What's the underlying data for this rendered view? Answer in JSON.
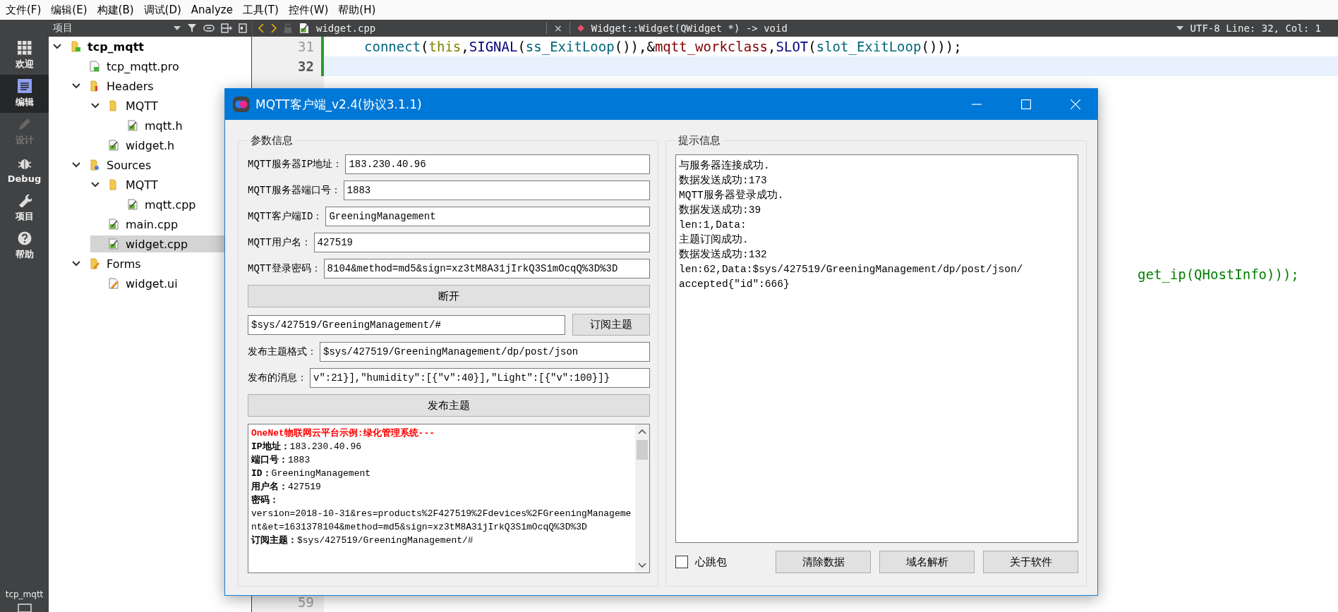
{
  "menu_bar": [
    "文件(F)",
    "编辑(E)",
    "构建(B)",
    "调试(D)",
    "Analyze",
    "工具(T)",
    "控件(W)",
    "帮助(H)"
  ],
  "mode_bar": {
    "modes": [
      {
        "label": "欢迎",
        "kind": "welcome",
        "selected": false,
        "disabled": false
      },
      {
        "label": "编辑",
        "kind": "edit",
        "selected": true,
        "disabled": false
      },
      {
        "label": "设计",
        "kind": "design",
        "selected": false,
        "disabled": true
      },
      {
        "label": "Debug",
        "kind": "debug",
        "selected": false,
        "disabled": false
      },
      {
        "label": "项目",
        "kind": "projects",
        "selected": false,
        "disabled": false
      },
      {
        "label": "帮助",
        "kind": "help",
        "selected": false,
        "disabled": false
      }
    ],
    "session": "tcp_mqtt"
  },
  "project_pane": {
    "title": "项目",
    "tree": [
      {
        "label": "tcp_mqtt",
        "kind": "project",
        "expanded": true,
        "selected": false,
        "children": [
          {
            "label": "tcp_mqtt.pro",
            "kind": "pro",
            "selected": false
          },
          {
            "label": "Headers",
            "kind": "headers",
            "expanded": true,
            "selected": false,
            "children": [
              {
                "label": "MQTT",
                "kind": "folder",
                "expanded": true,
                "selected": false,
                "children": [
                  {
                    "label": "mqtt.h",
                    "kind": "file",
                    "selected": false
                  }
                ]
              },
              {
                "label": "widget.h",
                "kind": "file",
                "selected": false
              }
            ]
          },
          {
            "label": "Sources",
            "kind": "sources",
            "expanded": true,
            "selected": false,
            "children": [
              {
                "label": "MQTT",
                "kind": "folder",
                "expanded": true,
                "selected": false,
                "children": [
                  {
                    "label": "mqtt.cpp",
                    "kind": "file",
                    "selected": false
                  }
                ]
              },
              {
                "label": "main.cpp",
                "kind": "file",
                "selected": false
              },
              {
                "label": "widget.cpp",
                "kind": "file",
                "selected": true
              }
            ]
          },
          {
            "label": "Forms",
            "kind": "forms",
            "expanded": true,
            "selected": false,
            "children": [
              {
                "label": "widget.ui",
                "kind": "ui",
                "selected": false
              }
            ]
          }
        ]
      }
    ]
  },
  "editor": {
    "file_tab": "widget.cpp",
    "close": "×",
    "function": "Widget::Widget(QWidget *) -> void",
    "position": "UTF-8 Line: 32, Col: 1",
    "lines": [
      {
        "number": "31",
        "current": false,
        "tokens": [
          {
            "text": "connect",
            "kind": "function"
          },
          {
            "text": "(",
            "kind": "plain"
          },
          {
            "text": "this",
            "kind": "keyword"
          },
          {
            "text": ",",
            "kind": "plain"
          },
          {
            "text": "SIGNAL",
            "kind": "macro"
          },
          {
            "text": "(",
            "kind": "plain"
          },
          {
            "text": "ss_ExitLoop",
            "kind": "function"
          },
          {
            "text": "()),&",
            "kind": "plain"
          },
          {
            "text": "mqtt_workclass",
            "kind": "member"
          },
          {
            "text": ",",
            "kind": "plain"
          },
          {
            "text": "SLOT",
            "kind": "macro"
          },
          {
            "text": "(",
            "kind": "plain"
          },
          {
            "text": "slot_ExitLoop",
            "kind": "function"
          },
          {
            "text": "()));",
            "kind": "plain"
          }
        ]
      },
      {
        "number": "32",
        "current": true
      }
    ],
    "partial_line": [
      {
        "text": "get_ip(QHostInfo)));",
        "kind": "comment"
      }
    ],
    "bottom_line_number": "59"
  },
  "dialog": {
    "title": "MQTT客户端_v2.4(协议3.1.1)",
    "params_group": {
      "title": "参数信息",
      "fields": [
        {
          "label": "MQTT服务器IP地址：",
          "value": "183.230.40.96"
        },
        {
          "label": "MQTT服务器端口号：",
          "value": "1883"
        },
        {
          "label": "MQTT客户端ID：",
          "value": "GreeningManagement"
        },
        {
          "label": "MQTT用户名：",
          "value": "427519"
        },
        {
          "label": "MQTT登录密码：",
          "value": "8104&method=md5&sign=xz3tM8A31jIrkQ3S1mOcqQ%3D%3D"
        }
      ],
      "disconnect_button": "断开",
      "subscribe": {
        "value": "$sys/427519/GreeningManagement/#",
        "button": "订阅主题"
      },
      "publish_fields": [
        {
          "label": "发布主题格式：",
          "value": "$sys/427519/GreeningManagement/dp/post/json"
        },
        {
          "label": "发布的消息：",
          "value": "v\":21}],\"humidity\":[{\"v\":40}],\"Light\":[{\"v\":100}]}"
        }
      ],
      "publish_button": "发布主题",
      "info_log": [
        {
          "kind": "heading",
          "text": "OneNet物联网云平台示例:绿化管理系统---"
        },
        {
          "kind": "line",
          "text": "**IP地址：**183.230.40.96"
        },
        {
          "kind": "line",
          "text": "**端口号：**1883"
        },
        {
          "kind": "line",
          "text": "**ID：**GreeningManagement"
        },
        {
          "kind": "line",
          "text": "**用户名：**427519"
        },
        {
          "kind": "label",
          "text": "密码："
        },
        {
          "kind": "line",
          "text": "version=2018-10-31&res=products%2F427519%2Fdevices%2FGreeningManagement&et=1631378104&method=md5&sign=xz3tM8A31jIrkQ3S1mOcqQ%3D%3D"
        },
        {
          "kind": "line",
          "text": "**订阅主题：**$sys/427519/GreeningManagement/#"
        }
      ]
    },
    "hint_group": {
      "title": "提示信息",
      "log": [
        "与服务器连接成功.",
        "数据发送成功:173",
        "MQTT服务器登录成功.",
        "数据发送成功:39",
        "len:1,Data:",
        "主题订阅成功.",
        "数据发送成功:132",
        "len:62,Data:$sys/427519/GreeningManagement/dp/post/json/",
        "accepted{\"id\":666}"
      ],
      "heartbeat": {
        "label": "心跳包",
        "checked": false
      },
      "buttons": [
        "清除数据",
        "域名解析",
        "关于软件"
      ]
    }
  }
}
